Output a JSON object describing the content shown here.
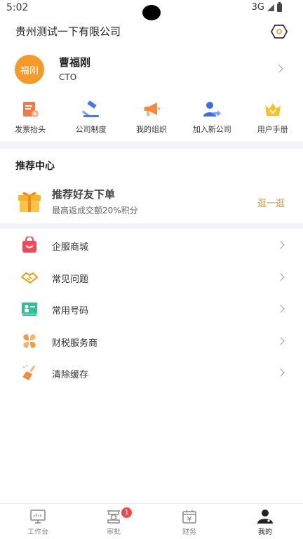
{
  "status_bar": {
    "time": "5:02",
    "network": "3G"
  },
  "header": {
    "company_name": "贵州测试一下有限公司"
  },
  "profile": {
    "avatar_text": "福刚",
    "name": "曹福刚",
    "role": "CTO"
  },
  "quick_actions": [
    {
      "label": "发票抬头",
      "icon": "invoice-icon"
    },
    {
      "label": "公司制度",
      "icon": "gavel-icon"
    },
    {
      "label": "我的组织",
      "icon": "megaphone-icon"
    },
    {
      "label": "加入新公司",
      "icon": "add-user-icon"
    },
    {
      "label": "用户手册",
      "icon": "crown-icon"
    }
  ],
  "recommend": {
    "section_title": "推荐中心",
    "title": "推荐好友下单",
    "subtitle": "最高返成交额20%积分",
    "link_label": "逛一逛"
  },
  "menu": [
    {
      "label": "企服商城",
      "icon": "shopping-bag-icon"
    },
    {
      "label": "常见问题",
      "icon": "handshake-icon"
    },
    {
      "label": "常用号码",
      "icon": "presentation-icon"
    },
    {
      "label": "财税服务商",
      "icon": "petals-icon"
    },
    {
      "label": "清除缓存",
      "icon": "broom-icon"
    }
  ],
  "tabbar": [
    {
      "label": "工作台",
      "icon": "monitor-icon",
      "active": false
    },
    {
      "label": "审批",
      "icon": "approval-icon",
      "active": false,
      "badge": "1"
    },
    {
      "label": "财务",
      "icon": "calendar-finance-icon",
      "active": false
    },
    {
      "label": "我的",
      "icon": "person-icon",
      "active": true
    }
  ],
  "colors": {
    "avatar": "#f39a2b",
    "link": "#c89a52",
    "badge": "#f04848",
    "divider": "#f4f4f6"
  }
}
